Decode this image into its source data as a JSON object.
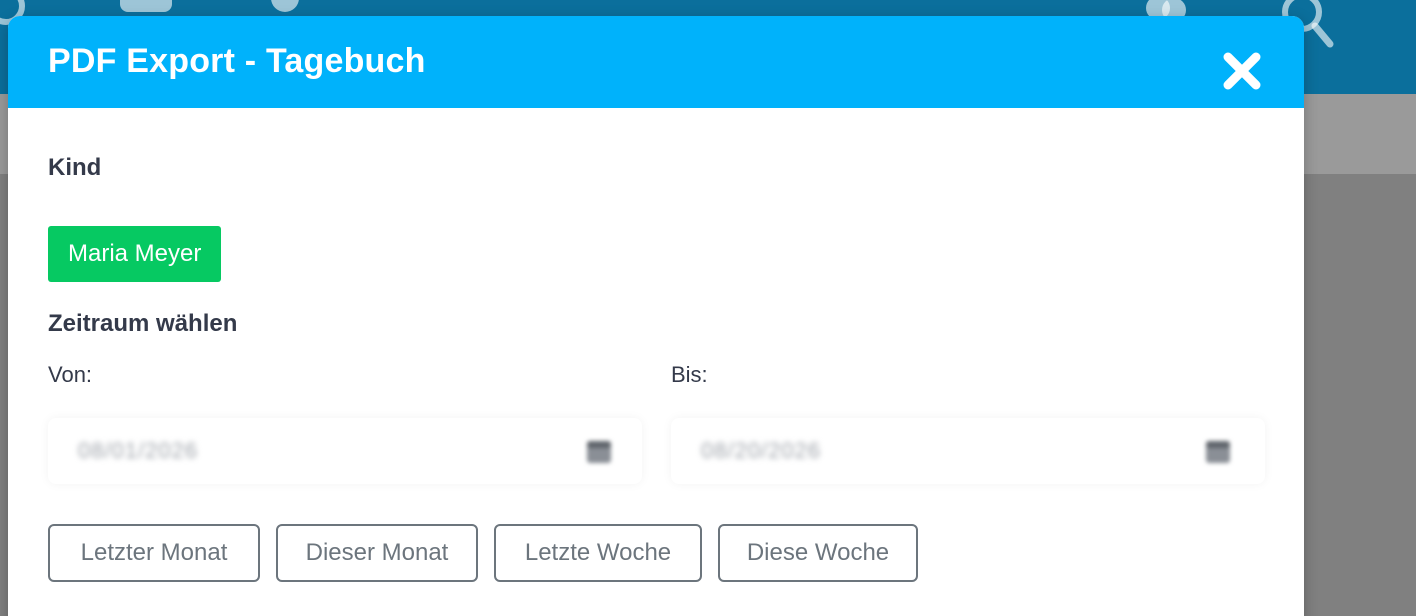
{
  "modal": {
    "title": "PDF Export - Tagebuch"
  },
  "child": {
    "section_label": "Kind",
    "selected_name": "Maria Meyer"
  },
  "period": {
    "section_label": "Zeitraum wählen",
    "from_label": "Von:",
    "to_label": "Bis:",
    "from_value": "08/01/2026",
    "to_value": "08/20/2026"
  },
  "quick_ranges": [
    "Letzter Monat",
    "Dieser Monat",
    "Letzte Woche",
    "Diese Woche"
  ],
  "icons": {
    "close": "close-icon",
    "calendar": "calendar-icon"
  },
  "colors": {
    "header": "#00b2fb",
    "chip": "#06c962",
    "button_border": "#6c757d",
    "app_topbar": "#0b6f9c"
  }
}
